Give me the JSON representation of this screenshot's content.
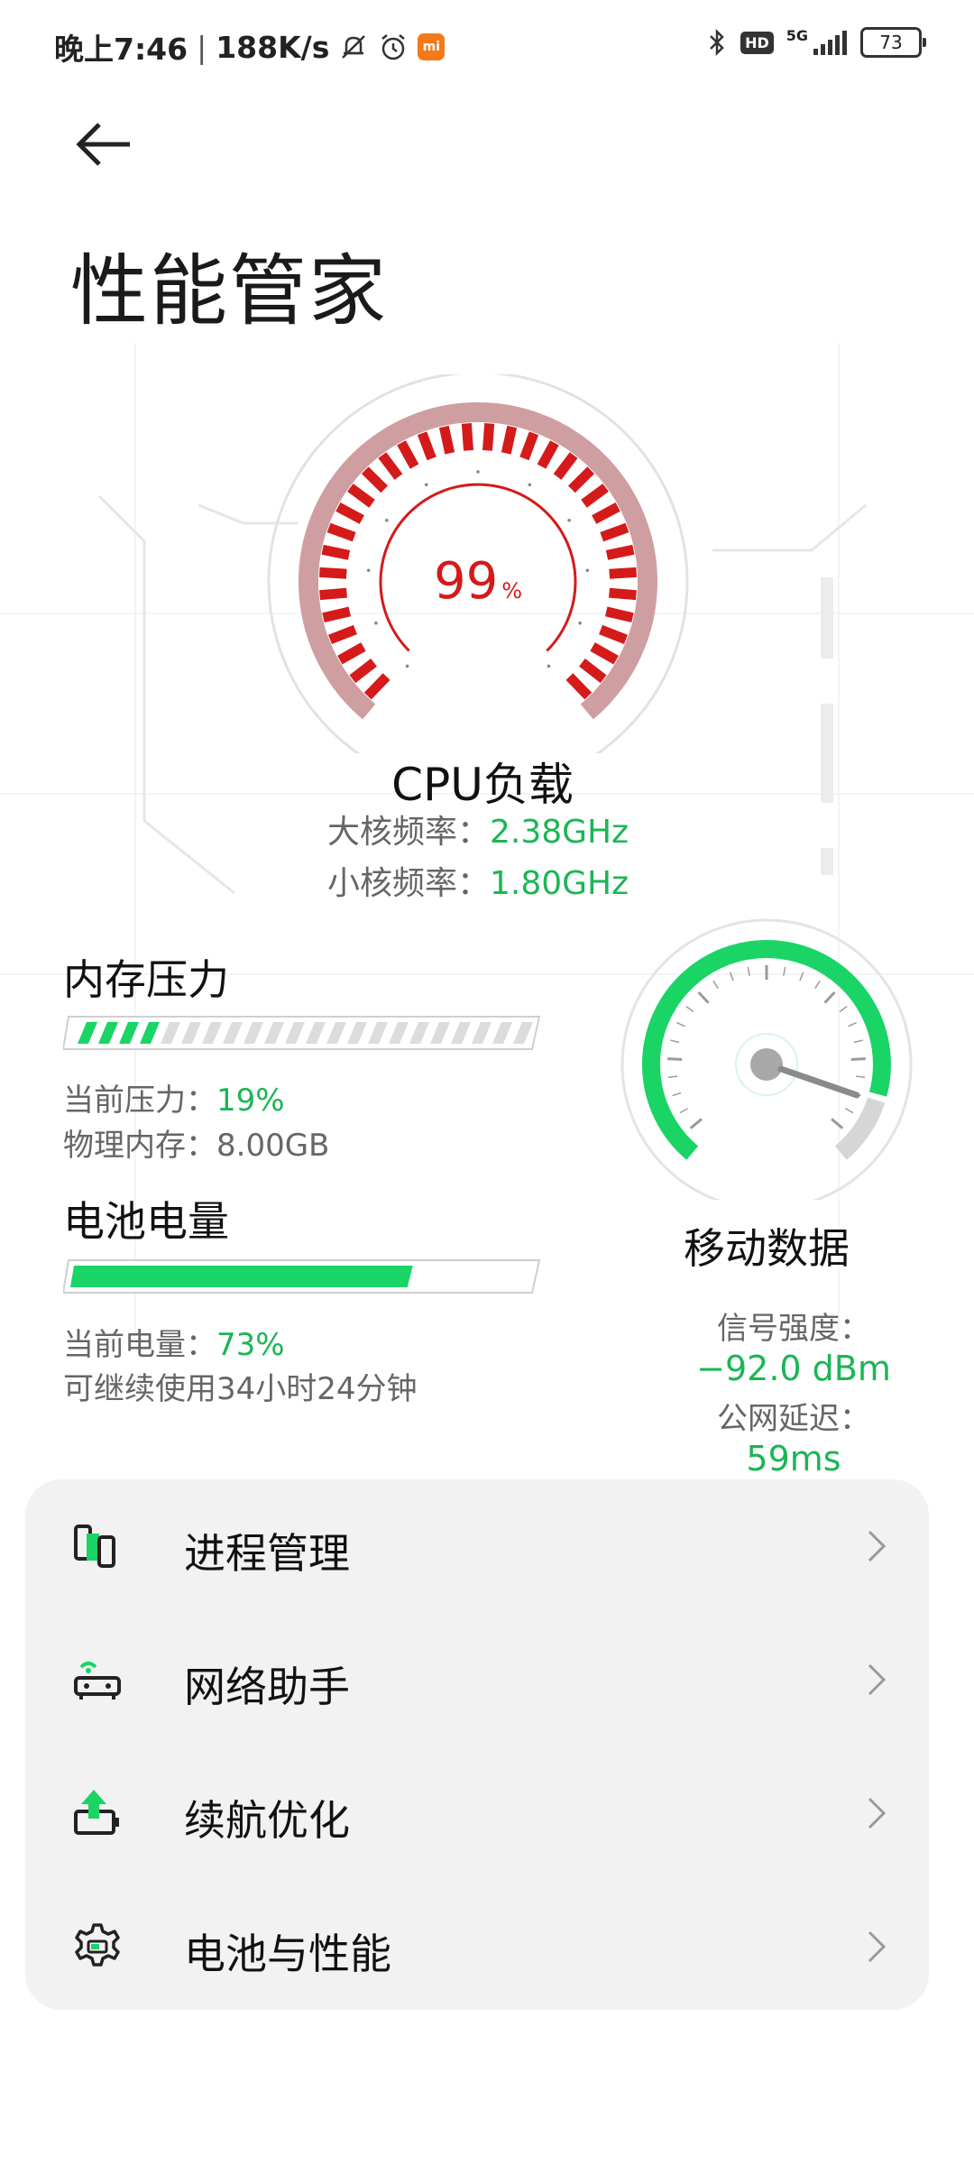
{
  "status_bar": {
    "time": "晚上7:46",
    "speed": "188K/s",
    "battery": "73",
    "hd_label": "HD",
    "network": "5G",
    "mi_badge": "mi"
  },
  "page": {
    "title": "性能管家"
  },
  "cpu": {
    "load_value": "99",
    "load_unit": "%",
    "load_fraction": 0.99,
    "label": "CPU负载",
    "big_core_label": "大核频率：",
    "big_core_value": "2.38GHz",
    "small_core_label": "小核频率：",
    "small_core_value": "1.80GHz",
    "color": "#d51a1a"
  },
  "memory": {
    "title": "内存压力",
    "pressure_fraction": 0.19,
    "pressure_label": "当前压力：",
    "pressure_value": "19%",
    "physical_label": "物理内存：",
    "physical_value": "8.00GB"
  },
  "battery": {
    "title": "电池电量",
    "level_fraction": 0.73,
    "level_label": "当前电量：",
    "level_value": "73%",
    "remaining": "可继续使用34小时24分钟"
  },
  "mobile_data": {
    "title": "移动数据",
    "signal_label": "信号强度：",
    "signal_value": "−92.0 dBm",
    "latency_label": "公网延迟：",
    "latency_value": "59ms",
    "color": "#1ad466"
  },
  "menu": [
    {
      "label": "进程管理",
      "icon": "process-icon"
    },
    {
      "label": "网络助手",
      "icon": "router-icon"
    },
    {
      "label": "续航优化",
      "icon": "battery-boost-icon"
    },
    {
      "label": "电池与性能",
      "icon": "gear-icon"
    }
  ],
  "colors": {
    "accent_green": "#1bb655",
    "cpu_red": "#d51a1a",
    "card_bg": "#f2f2f2"
  }
}
